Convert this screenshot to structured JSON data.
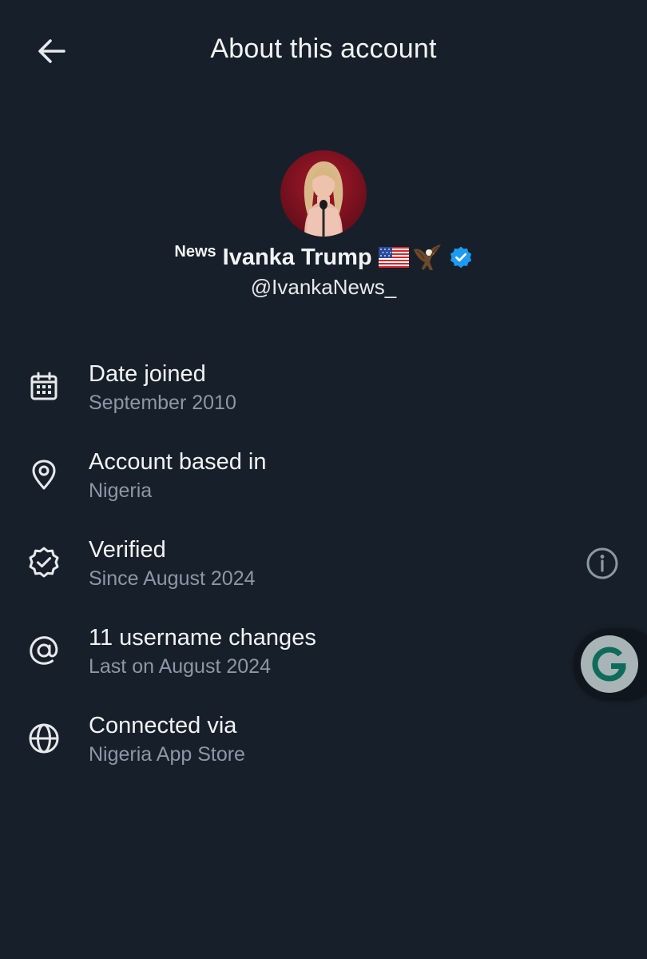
{
  "header": {
    "title": "About this account"
  },
  "profile": {
    "name_prefix": "News",
    "display_name": "Ivanka Trump",
    "emojis": [
      "flag-us-icon",
      "eagle-icon"
    ],
    "verified": true,
    "handle": "@IvankaNews_"
  },
  "details": [
    {
      "icon": "calendar-icon",
      "title": "Date joined",
      "subtitle": "September 2010"
    },
    {
      "icon": "location-pin-icon",
      "title": "Account based in",
      "subtitle": "Nigeria"
    },
    {
      "icon": "verified-badge-icon",
      "title": "Verified",
      "subtitle": "Since August 2024"
    },
    {
      "icon": "at-sign-icon",
      "title": "11 username changes",
      "subtitle": "Last on August 2024"
    },
    {
      "icon": "globe-icon",
      "title": "Connected via",
      "subtitle": "Nigeria App Store"
    }
  ],
  "colors": {
    "background": "#17202a",
    "primary_text": "#e7e9ea",
    "secondary_text": "#8b98a5",
    "verified_blue": "#1d9bf0",
    "float_button_teal": "#0e6b5c"
  }
}
